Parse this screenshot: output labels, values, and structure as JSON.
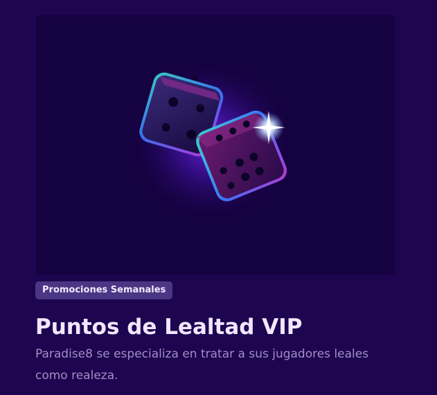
{
  "promo": {
    "image_alt": "dice-illustration",
    "tag": "Promociones Semanales",
    "title": "Puntos de Lealtad VIP",
    "description": "Paradise8 se especializa en tratar a sus jugadores leales como realeza."
  },
  "colors": {
    "page_background": "#1d0550",
    "hero_background": "#150240",
    "tag_background": "#4b3683",
    "title_text": "#f2e7ff",
    "description_text": "#a28fc6"
  }
}
